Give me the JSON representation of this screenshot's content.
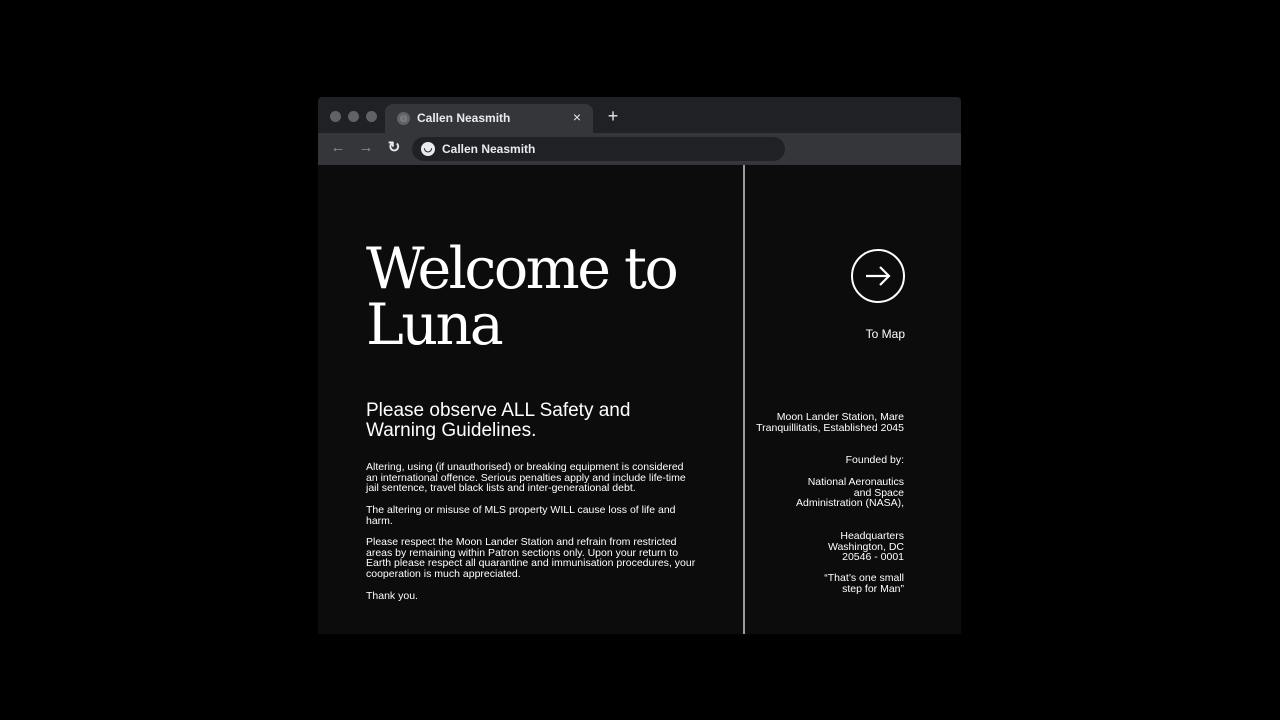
{
  "browser": {
    "tab_title": "Callen Neasmith",
    "tab_close": "×",
    "new_tab": "+",
    "address": "Callen Neasmith",
    "back": "←",
    "forward": "→",
    "reload": "↻"
  },
  "page": {
    "heading_line1": "Welcome to",
    "heading_line2": "Luna",
    "subheading": "Please observe ALL Safety and Warning Guidelines.",
    "paragraphs": [
      "Altering, using (if unauthorised) or breaking equipment is considered an international offence. Serious penalties apply and include life-time jail sentence, travel black lists and inter-generational debt.",
      "The altering or misuse of MLS property WILL cause loss of life and harm.",
      "Please respect the Moon Lander Station and refrain from restricted areas by remaining within Patron sections only. Upon your return to Earth please respect all quarantine and immunisation procedures, your cooperation is much appreciated.",
      "Thank you."
    ],
    "to_map_label": "To Map",
    "sidebar": {
      "station": "Moon Lander Station, Mare Tranquillitatis, Established 2045",
      "founded_by": "Founded by:",
      "founder": "National Aeronautics and Space Administration (NASA),",
      "headquarters": "Headquarters Washington, DC 20546 - 0001",
      "quote": "“That’s one small step for Man”"
    }
  },
  "colors": {
    "background": "#000000",
    "page_background": "#0c0c0c",
    "tab_strip": "#202124",
    "toolbar": "#35363a",
    "divider": "#9c9c9c",
    "text": "#ffffff"
  },
  "icons": {
    "window_controls": "traffic-light-dots",
    "tab_favicon": "globe-icon",
    "to_map": "arrow-right-circle-icon"
  }
}
